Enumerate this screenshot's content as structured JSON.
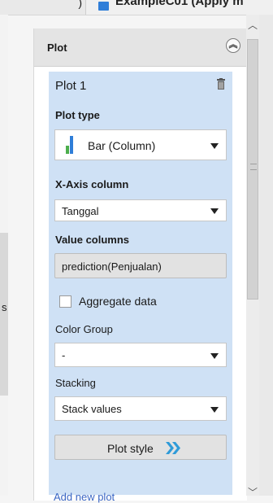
{
  "window": {
    "left_tab_fragment": ")",
    "tab_title": "ExampleC01 (Apply m"
  },
  "left_clip_text": "s",
  "panel": {
    "title": "Plot",
    "collapse_icon": "double-chevron-up-icon"
  },
  "plot": {
    "name": "Plot 1",
    "delete_icon": "trash-icon",
    "plot_type_label": "Plot type",
    "plot_type_value": "Bar (Column)",
    "x_axis_label": "X-Axis column",
    "x_axis_value": "Tanggal",
    "value_columns_label": "Value columns",
    "value_columns_value": "prediction(Penjualan)",
    "aggregate_label": "Aggregate data",
    "aggregate_checked": false,
    "color_group_label": "Color Group",
    "color_group_value": "-",
    "stacking_label": "Stacking",
    "stacking_value": "Stack values",
    "plot_style_label": "Plot style",
    "plot_style_icon": "double-chevron-right-icon"
  },
  "footer_link": "Add new plot",
  "colors": {
    "card_bg": "#cfe1f5",
    "header_bg": "#e4e4e4",
    "accent": "#2f9bd8",
    "bar_icon": [
      "#4cae4c",
      "#2f7ed8"
    ]
  }
}
